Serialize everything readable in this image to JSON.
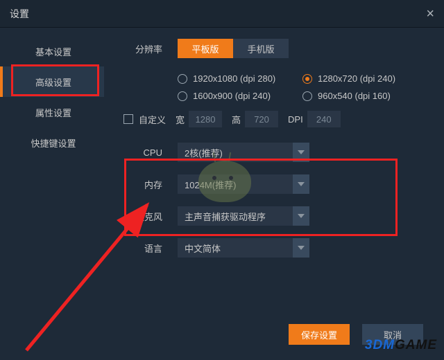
{
  "window": {
    "title": "设置"
  },
  "sidebar": {
    "items": [
      "基本设置",
      "高级设置",
      "属性设置",
      "快捷键设置"
    ],
    "active_index": 1
  },
  "resolution": {
    "label": "分辨率",
    "tabs": {
      "tablet": "平板版",
      "phone": "手机版"
    },
    "options": [
      "1920x1080 (dpi 280)",
      "1280x720 (dpi 240)",
      "1600x900 (dpi 240)",
      "960x540 (dpi 160)"
    ],
    "selected_index": 1,
    "custom": {
      "label": "自定义",
      "width_label": "宽",
      "width_value": "1280",
      "height_label": "高",
      "height_value": "720",
      "dpi_label": "DPI",
      "dpi_value": "240"
    }
  },
  "settings": {
    "cpu": {
      "label": "CPU",
      "value": "2核(推荐)"
    },
    "memory": {
      "label": "内存",
      "value": "1024M(推荐)"
    },
    "mic": {
      "label": "麦克风",
      "value": "主声音捕获驱动程序"
    },
    "lang": {
      "label": "语言",
      "value": "中文简体"
    }
  },
  "footer": {
    "save": "保存设置",
    "cancel": "取消"
  },
  "watermark": {
    "a": "3DM",
    "b": "GAME"
  }
}
